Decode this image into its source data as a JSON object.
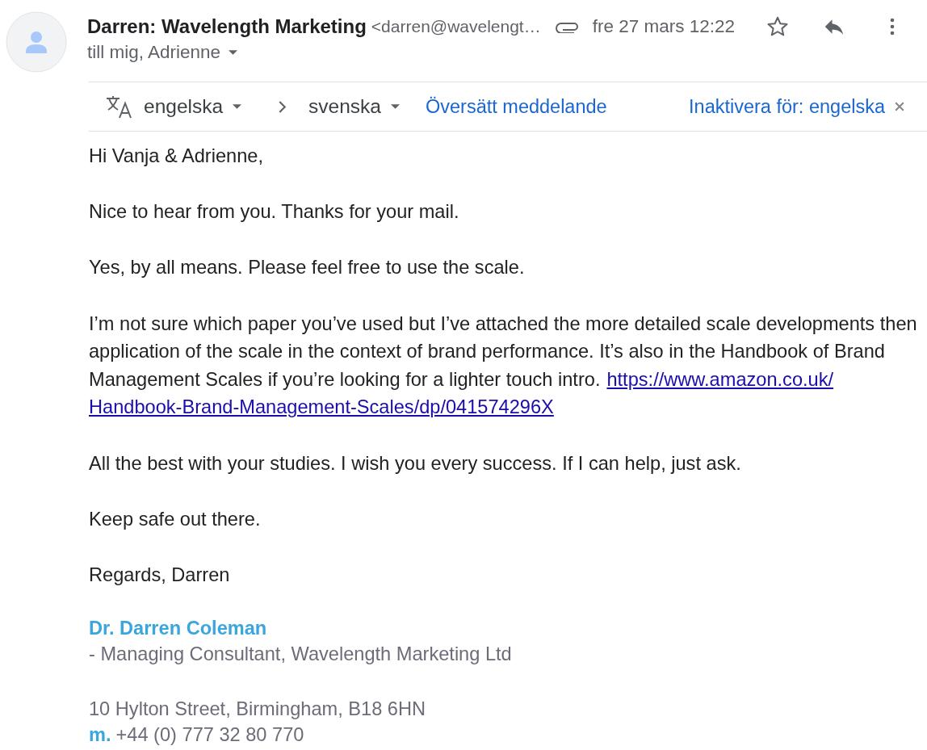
{
  "header": {
    "sender_name": "Darren: Wavelength Marketing",
    "sender_email": "<darren@wavelengt…",
    "date": "fre 27 mars 12:22",
    "recipients": "till mig, Adrienne"
  },
  "translation_bar": {
    "source_language": "engelska",
    "target_language": "svenska",
    "translate_link": "Översätt meddelande",
    "disable_link": "Inaktivera för: engelska"
  },
  "body": {
    "paragraphs": [
      {
        "text": "Hi Vanja & Adrienne,"
      },
      {
        "text": "Nice to hear from you. Thanks for your mail."
      },
      {
        "text": "Yes, by all means. Please feel free to use the scale."
      },
      {
        "text": "I’m not sure which paper you’ve used but I’ve attached the more detailed scale developments then application of the scale in the context of brand performance. It’s also in the Handbook of Brand Management Scales if you’re looking for a lighter touch intro.",
        "link_lines": [
          "https://www.amazon.co.uk/",
          "Handbook-Brand-Management-Scales/dp/041574296X"
        ]
      },
      {
        "text": "All the best with your studies. I wish you every success. If I can help, just ask."
      },
      {
        "text": "Keep safe out there."
      },
      {
        "text": "Regards, Darren"
      }
    ]
  },
  "signature": {
    "name": "Dr. Darren Coleman",
    "title": "- Managing Consultant, Wavelength Marketing Ltd",
    "address": "10 Hylton Street, Birmingham, B18 6HN",
    "phone_label": "m.",
    "phone": "+44 (0) 777 32 80 770"
  }
}
